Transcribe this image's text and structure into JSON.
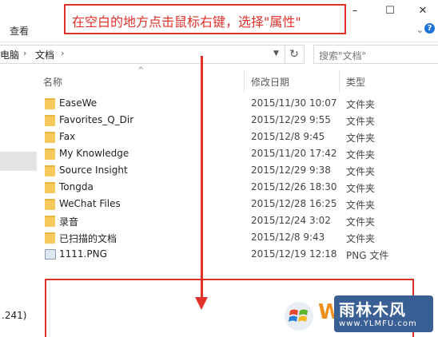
{
  "ribbon": {
    "tab_view": "查看",
    "minimize": "–",
    "maximize": "☐",
    "close": "✕",
    "help": "?"
  },
  "address": {
    "crumb_pc": "电脑",
    "crumb_docs": "文档",
    "refresh_icon": "refresh-icon"
  },
  "search": {
    "placeholder": "搜索\"文档\""
  },
  "columns": {
    "name": "名称",
    "date": "修改日期",
    "type": "类型"
  },
  "files": [
    {
      "name": "EaseWe",
      "date": "2015/11/30 10:07",
      "type": "文件夹",
      "icon": "folder-icon"
    },
    {
      "name": "Favorites_Q_Dir",
      "date": "2015/12/29 9:55",
      "type": "文件夹",
      "icon": "folder-icon"
    },
    {
      "name": "Fax",
      "date": "2015/12/8 9:45",
      "type": "文件夹",
      "icon": "folder-icon"
    },
    {
      "name": "My Knowledge",
      "date": "2015/11/20 17:42",
      "type": "文件夹",
      "icon": "folder-icon"
    },
    {
      "name": "Source Insight",
      "date": "2015/12/29 9:38",
      "type": "文件夹",
      "icon": "folder-icon"
    },
    {
      "name": "Tongda",
      "date": "2015/12/26 18:30",
      "type": "文件夹",
      "icon": "folder-icon"
    },
    {
      "name": "WeChat Files",
      "date": "2015/12/28 16:25",
      "type": "文件夹",
      "icon": "folder-icon"
    },
    {
      "name": "录音",
      "date": "2015/12/24 3:02",
      "type": "文件夹",
      "icon": "folder-icon"
    },
    {
      "name": "已扫描的文档",
      "date": "2015/12/8 9:43",
      "type": "文件夹",
      "icon": "folder-icon"
    },
    {
      "name": "1111.PNG",
      "date": "2015/12/19 12:18",
      "type": "PNG 文件",
      "icon": "image-file-icon"
    }
  ],
  "nav": {
    "partial_text": ".241)"
  },
  "annotation": {
    "instruction": "在空白的地方点击鼠标右键，选择\"属性\"",
    "color": "#e0312b"
  },
  "watermark": {
    "letter": "W",
    "name": "雨林木风",
    "url": "www.YLMFU.com"
  }
}
